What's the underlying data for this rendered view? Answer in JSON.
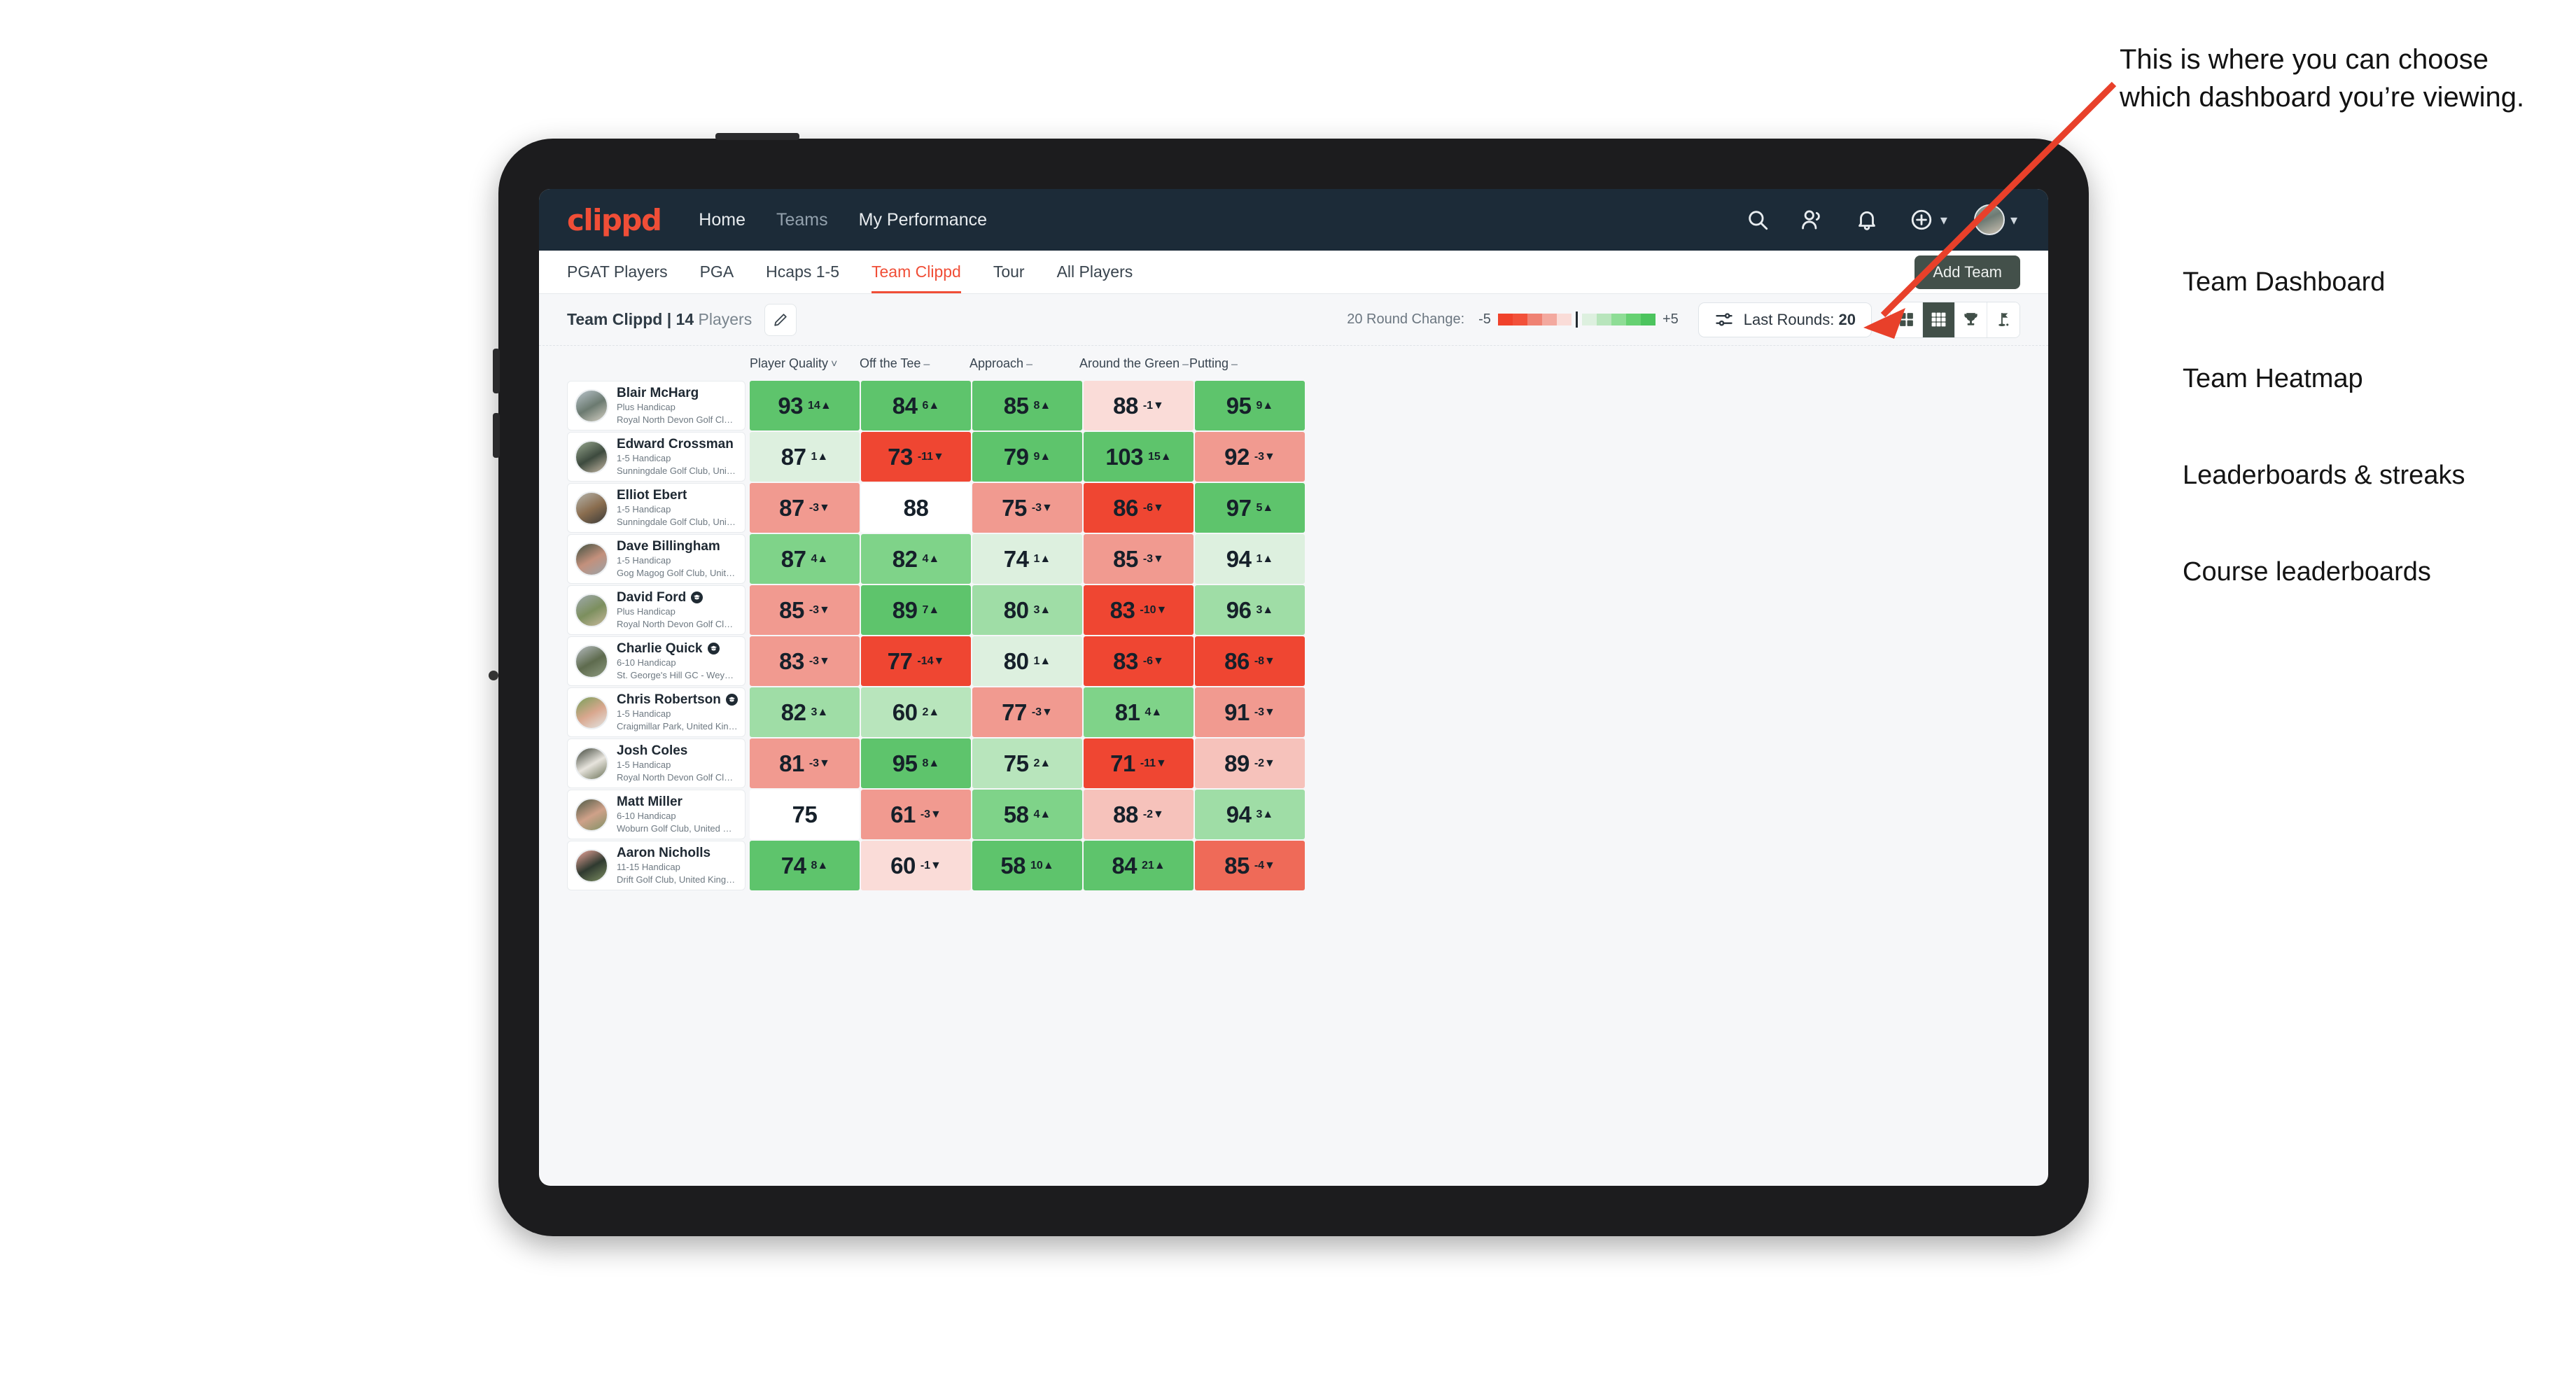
{
  "topbar": {
    "brand": "clippd",
    "nav": [
      {
        "label": "Home",
        "active": true
      },
      {
        "label": "Teams",
        "active": false
      },
      {
        "label": "My Performance",
        "active": true
      }
    ],
    "icons": [
      "search-icon",
      "people-icon",
      "bell-icon",
      "plus-circle-icon"
    ],
    "avatar": "user-avatar"
  },
  "subnav": {
    "tabs": [
      {
        "label": "PGAT Players",
        "state": "normal"
      },
      {
        "label": "PGA",
        "state": "normal"
      },
      {
        "label": "Hcaps 1-5",
        "state": "normal"
      },
      {
        "label": "Team Clippd",
        "state": "active"
      },
      {
        "label": "Tour",
        "state": "normal"
      },
      {
        "label": "All Players",
        "state": "normal"
      }
    ],
    "add_team_label": "Add Team"
  },
  "toolbar": {
    "team_name": "Team Clippd",
    "separator": " | ",
    "player_count": "14",
    "players_word": "Players",
    "edit_icon": "pencil-icon",
    "round_change_label": "20 Round Change:",
    "scale_min": "-5",
    "scale_max": "+5",
    "scale_colors": [
      "#f0422b",
      "#f2513a",
      "#ef8273",
      "#f3a99f",
      "#fadcd8",
      "#ddf0df",
      "#b8e5bc",
      "#8edd96",
      "#66d172",
      "#4cc45e"
    ],
    "last_rounds_prefix": "Last Rounds:",
    "last_rounds_value": "20",
    "view_buttons": [
      {
        "name": "team-dashboard-view",
        "icon": "grid-2x2-icon",
        "active": false
      },
      {
        "name": "team-heatmap-view",
        "icon": "grid-3x3-icon",
        "active": true
      },
      {
        "name": "leaderboards-streaks-view",
        "icon": "trophy-icon",
        "active": false
      },
      {
        "name": "course-leaderboards-view",
        "icon": "golf-flag-icon",
        "active": false
      }
    ]
  },
  "grid": {
    "name_column_header": "",
    "columns": [
      {
        "label": "Player Quality",
        "mark": "˅"
      },
      {
        "label": "Off the Tee",
        "mark": "–"
      },
      {
        "label": "Approach",
        "mark": "–"
      },
      {
        "label": "Around the Green",
        "mark": "–"
      },
      {
        "label": "Putting",
        "mark": "–"
      }
    ],
    "rows": [
      {
        "name": "Blair McHarg",
        "badge": false,
        "handicap": "Plus Handicap",
        "club": "Royal North Devon Golf Club, United Kingdom",
        "avatar_colors": [
          "#b9c4cb",
          "#6b7a70",
          "#d7d2c6"
        ],
        "cells": [
          {
            "value": "93",
            "delta": "14",
            "dir": "up",
            "bg": "#5ec46c"
          },
          {
            "value": "84",
            "delta": "6",
            "dir": "up",
            "bg": "#5ec46c"
          },
          {
            "value": "85",
            "delta": "8",
            "dir": "up",
            "bg": "#5ec46c"
          },
          {
            "value": "88",
            "delta": "-1",
            "dir": "down",
            "bg": "#fadcd8"
          },
          {
            "value": "95",
            "delta": "9",
            "dir": "up",
            "bg": "#5ec46c"
          }
        ]
      },
      {
        "name": "Edward Crossman",
        "badge": false,
        "handicap": "1-5 Handicap",
        "club": "Sunningdale Golf Club, United Kingdom",
        "avatar_colors": [
          "#98a88f",
          "#3d4a3e",
          "#c7b9a6"
        ],
        "cells": [
          {
            "value": "87",
            "delta": "1",
            "dir": "up",
            "bg": "#ddf0df"
          },
          {
            "value": "73",
            "delta": "-11",
            "dir": "down",
            "bg": "#ef4632"
          },
          {
            "value": "79",
            "delta": "9",
            "dir": "up",
            "bg": "#5ec46c"
          },
          {
            "value": "103",
            "delta": "15",
            "dir": "up",
            "bg": "#5ec46c"
          },
          {
            "value": "92",
            "delta": "-3",
            "dir": "down",
            "bg": "#f19a90"
          }
        ]
      },
      {
        "name": "Elliot Ebert",
        "badge": false,
        "handicap": "1-5 Handicap",
        "club": "Sunningdale Golf Club, United Kingdom",
        "avatar_colors": [
          "#b5b5ad",
          "#8a6d4f",
          "#3a3a38"
        ],
        "cells": [
          {
            "value": "87",
            "delta": "-3",
            "dir": "down",
            "bg": "#f19a90"
          },
          {
            "value": "88",
            "delta": "",
            "dir": "",
            "bg": "#ffffff"
          },
          {
            "value": "75",
            "delta": "-3",
            "dir": "down",
            "bg": "#f19a90"
          },
          {
            "value": "86",
            "delta": "-6",
            "dir": "down",
            "bg": "#ef4632"
          },
          {
            "value": "97",
            "delta": "5",
            "dir": "up",
            "bg": "#5ec46c"
          }
        ]
      },
      {
        "name": "Dave Billingham",
        "badge": false,
        "handicap": "1-5 Handicap",
        "club": "Gog Magog Golf Club, United Kingdom",
        "avatar_colors": [
          "#3f5040",
          "#c3907c",
          "#9aa3a8"
        ],
        "cells": [
          {
            "value": "87",
            "delta": "4",
            "dir": "up",
            "bg": "#7fd389"
          },
          {
            "value": "82",
            "delta": "4",
            "dir": "up",
            "bg": "#7fd389"
          },
          {
            "value": "74",
            "delta": "1",
            "dir": "up",
            "bg": "#ddf0df"
          },
          {
            "value": "85",
            "delta": "-3",
            "dir": "down",
            "bg": "#f19a90"
          },
          {
            "value": "94",
            "delta": "1",
            "dir": "up",
            "bg": "#ddf0df"
          }
        ]
      },
      {
        "name": "David Ford",
        "badge": true,
        "handicap": "Plus Handicap",
        "club": "Royal North Devon Golf Club, United Kingdom",
        "avatar_colors": [
          "#9fa9ad",
          "#7c8f5e",
          "#c8b99d"
        ],
        "cells": [
          {
            "value": "85",
            "delta": "-3",
            "dir": "down",
            "bg": "#f19a90"
          },
          {
            "value": "89",
            "delta": "7",
            "dir": "up",
            "bg": "#5ec46c"
          },
          {
            "value": "80",
            "delta": "3",
            "dir": "up",
            "bg": "#9fdda6"
          },
          {
            "value": "83",
            "delta": "-10",
            "dir": "down",
            "bg": "#ef4632"
          },
          {
            "value": "96",
            "delta": "3",
            "dir": "up",
            "bg": "#9fdda6"
          }
        ]
      },
      {
        "name": "Charlie Quick",
        "badge": true,
        "handicap": "6-10 Handicap",
        "club": "St. George's Hill GC - Weybridge - Surrey, Uni...",
        "avatar_colors": [
          "#b6bcc0",
          "#5e6b4e",
          "#8d9a80"
        ],
        "cells": [
          {
            "value": "83",
            "delta": "-3",
            "dir": "down",
            "bg": "#f19a90"
          },
          {
            "value": "77",
            "delta": "-14",
            "dir": "down",
            "bg": "#ef4632"
          },
          {
            "value": "80",
            "delta": "1",
            "dir": "up",
            "bg": "#ddf0df"
          },
          {
            "value": "83",
            "delta": "-6",
            "dir": "down",
            "bg": "#ef4632"
          },
          {
            "value": "86",
            "delta": "-8",
            "dir": "down",
            "bg": "#ef4632"
          }
        ]
      },
      {
        "name": "Chris Robertson",
        "badge": true,
        "handicap": "1-5 Handicap",
        "club": "Craigmillar Park, United Kingdom",
        "avatar_colors": [
          "#78a05a",
          "#d9a78e",
          "#e3e6e4"
        ],
        "cells": [
          {
            "value": "82",
            "delta": "3",
            "dir": "up",
            "bg": "#9fdda6"
          },
          {
            "value": "60",
            "delta": "2",
            "dir": "up",
            "bg": "#b8e5bc"
          },
          {
            "value": "77",
            "delta": "-3",
            "dir": "down",
            "bg": "#f19a90"
          },
          {
            "value": "81",
            "delta": "4",
            "dir": "up",
            "bg": "#7fd389"
          },
          {
            "value": "91",
            "delta": "-3",
            "dir": "down",
            "bg": "#f19a90"
          }
        ]
      },
      {
        "name": "Josh Coles",
        "badge": false,
        "handicap": "1-5 Handicap",
        "club": "Royal North Devon Golf Club, United Kingdom",
        "avatar_colors": [
          "#3d4338",
          "#e7e4dd",
          "#6b7258"
        ],
        "cells": [
          {
            "value": "81",
            "delta": "-3",
            "dir": "down",
            "bg": "#f19a90"
          },
          {
            "value": "95",
            "delta": "8",
            "dir": "up",
            "bg": "#5ec46c"
          },
          {
            "value": "75",
            "delta": "2",
            "dir": "up",
            "bg": "#b8e5bc"
          },
          {
            "value": "71",
            "delta": "-11",
            "dir": "down",
            "bg": "#ef4632"
          },
          {
            "value": "89",
            "delta": "-2",
            "dir": "down",
            "bg": "#f6c2bb"
          }
        ]
      },
      {
        "name": "Matt Miller",
        "badge": false,
        "handicap": "6-10 Handicap",
        "club": "Woburn Golf Club, United Kingdom",
        "avatar_colors": [
          "#4c5945",
          "#cfa189",
          "#7f9165"
        ],
        "cells": [
          {
            "value": "75",
            "delta": "",
            "dir": "",
            "bg": "#ffffff"
          },
          {
            "value": "61",
            "delta": "-3",
            "dir": "down",
            "bg": "#f19a90"
          },
          {
            "value": "58",
            "delta": "4",
            "dir": "up",
            "bg": "#7fd389"
          },
          {
            "value": "88",
            "delta": "-2",
            "dir": "down",
            "bg": "#f6c2bb"
          },
          {
            "value": "94",
            "delta": "3",
            "dir": "up",
            "bg": "#9fdda6"
          }
        ]
      },
      {
        "name": "Aaron Nicholls",
        "badge": false,
        "handicap": "11-15 Handicap",
        "club": "Drift Golf Club, United Kingdom",
        "avatar_colors": [
          "#efa79c",
          "#2f3a30",
          "#7e8f62"
        ],
        "cells": [
          {
            "value": "74",
            "delta": "8",
            "dir": "up",
            "bg": "#5ec46c"
          },
          {
            "value": "60",
            "delta": "-1",
            "dir": "down",
            "bg": "#fadcd8"
          },
          {
            "value": "58",
            "delta": "10",
            "dir": "up",
            "bg": "#5ec46c"
          },
          {
            "value": "84",
            "delta": "21",
            "dir": "up",
            "bg": "#5ec46c"
          },
          {
            "value": "85",
            "delta": "-4",
            "dir": "down",
            "bg": "#ef6a58"
          }
        ]
      }
    ]
  },
  "annotation": {
    "callout": "This is where you can choose which dashboard you’re viewing.",
    "items": [
      "Team Dashboard",
      "Team Heatmap",
      "Leaderboards & streaks",
      "Course leaderboards"
    ],
    "arrow_color": "#e8402a"
  }
}
